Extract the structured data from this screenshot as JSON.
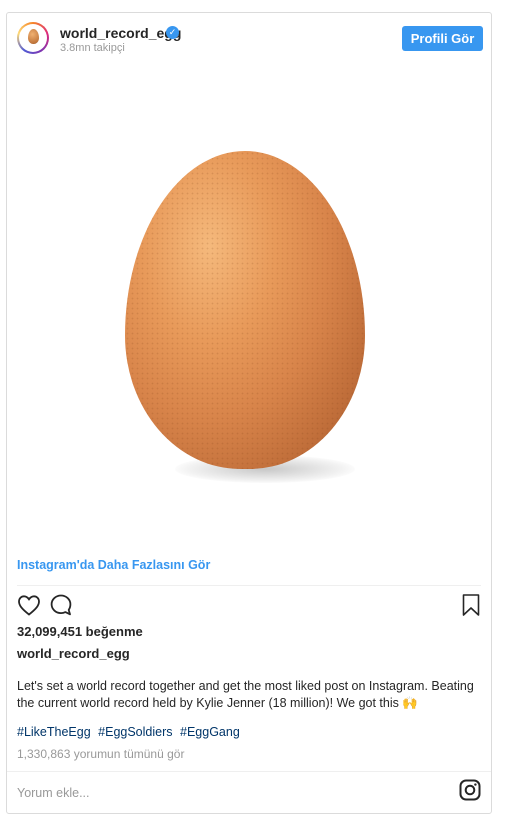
{
  "header": {
    "username": "world_record_egg",
    "followers": "3.8mn takipçi",
    "profile_button": "Profili Gör",
    "verified": true
  },
  "post": {
    "more_link": "Instagram'da Daha Fazlasını Gör",
    "likes": "32,099,451 beğenme",
    "caption_user": "world_record_egg",
    "caption": "Let's set a world record together and get the most liked post on Instagram. Beating the current world record held by Kylie Jenner (18 million)! We got this 🙌",
    "hashtags": [
      "#LikeTheEgg",
      "#EggSoldiers",
      "#EggGang"
    ],
    "comments_link": "1,330,863 yorumun tümünü gör",
    "comment_placeholder": "Yorum ekle..."
  },
  "icons": {
    "like": "heart-icon",
    "comment": "comment-icon",
    "save": "bookmark-icon",
    "brand": "instagram-icon",
    "verified": "verified-badge-icon"
  },
  "colors": {
    "accent": "#3897f0",
    "hashtag": "#003569",
    "muted": "#999999"
  }
}
